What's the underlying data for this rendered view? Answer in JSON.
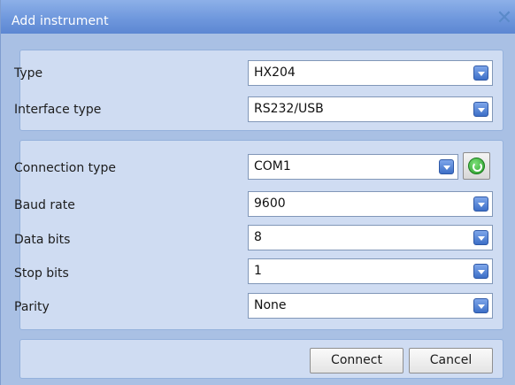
{
  "dialog": {
    "title": "Add instrument",
    "close_icon": "close-icon",
    "colors": {
      "titlebar": "#6f98dd",
      "panel": "#cfdcf2",
      "background": "#a9c0e4",
      "arrow": "#3d6fc7"
    }
  },
  "instrument": {
    "type_label": "Type",
    "type_value": "HX204",
    "interface_label": "Interface type",
    "interface_value": "RS232/USB"
  },
  "connection": {
    "connection_type_label": "Connection type",
    "connection_type_value": "COM1",
    "refresh_icon": "refresh-icon",
    "baud_label": "Baud rate",
    "baud_value": "9600",
    "data_bits_label": "Data bits",
    "data_bits_value": "8",
    "stop_bits_label": "Stop bits",
    "stop_bits_value": "1",
    "parity_label": "Parity",
    "parity_value": "None"
  },
  "actions": {
    "connect_label": "Connect",
    "cancel_label": "Cancel"
  }
}
